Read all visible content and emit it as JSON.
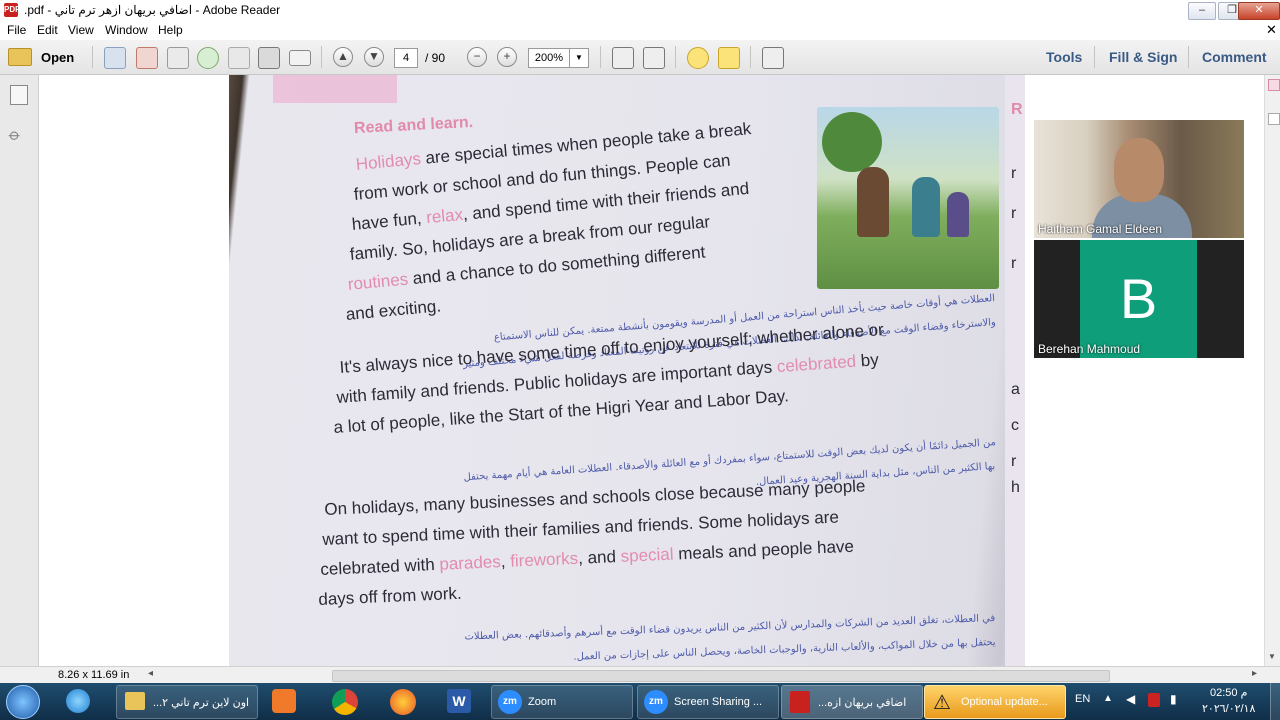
{
  "window": {
    "title": ".pdf - اضافي بريهان ازهر ترم تاني - Adobe Reader",
    "minimize": "–",
    "restore": "❐",
    "close": "✕"
  },
  "menu": [
    "File",
    "Edit",
    "View",
    "Window",
    "Help"
  ],
  "toolbar": {
    "open_label": "Open",
    "page_current": "4",
    "page_total": "/ 90",
    "zoom": "200%",
    "tools": "Tools",
    "fill_sign": "Fill & Sign",
    "comment": "Comment"
  },
  "document": {
    "heading": "Read and learn.",
    "p1": [
      {
        "pre": "",
        "hl": "Holidays",
        "post": " are special times when people take a break"
      },
      {
        "pre": "from work or school and do fun things. People can",
        "hl": "",
        "post": ""
      },
      {
        "pre": "have fun, ",
        "hl": "relax",
        "post": ", and spend time with their friends and"
      },
      {
        "pre": "family. So, holidays are a break from our regular",
        "hl": "",
        "post": ""
      },
      {
        "pre": "",
        "hl": "routines",
        "post": " and a chance to do something different"
      },
      {
        "pre": "and exciting.",
        "hl": "",
        "post": ""
      }
    ],
    "ar1": [
      "العطلات هي أوقات خاصة حيث يأخذ الناس استراحة من العمل أو المدرسة ويقومون بأنشطة ممتعة. يمكن للناس الاستمتاع",
      "والاسترخاء وقضاء الوقت مع الأصدقاء والعائلة. لذلك، العطلات هي فترة للابتعاد عن روتيننا المعتاد وفرصة لفعل شيء مختلف ومثير"
    ],
    "p2": [
      {
        "pre": "It's always nice to have some time off to enjoy yourself; whether alone or",
        "hl": "",
        "post": ""
      },
      {
        "pre": "with family and friends. Public holidays are important days ",
        "hl": "celebrated",
        "post": " by"
      },
      {
        "pre": "a lot of people, like the Start of the Higri Year and Labor Day.",
        "hl": "",
        "post": ""
      }
    ],
    "ar2": [
      "من الجميل دائمًا أن يكون لديك بعض الوقت للاستمتاع، سواء بمفردك أو مع العائلة والأصدقاء. العطلات العامة هي أيام مهمة يحتفل",
      "بها الكثير من الناس، مثل بداية السنة الهجرية وعيد العمال."
    ],
    "p3": [
      {
        "pre": "On holidays, many businesses and schools close because many people",
        "hl": "",
        "post": ""
      },
      {
        "pre": "want to spend time with their families and friends. Some holidays are",
        "hl": "",
        "post": ""
      },
      {
        "pre": "celebrated with ",
        "hl": "parades",
        "post": ", ",
        "hl2": "fireworks",
        "post2": ", and ",
        "hl3": "special",
        "post3": " meals and people have"
      },
      {
        "pre": "days off from work.",
        "hl": "",
        "post": ""
      }
    ],
    "ar3": [
      "في العطلات، تغلق العديد من الشركات والمدارس لأن الكثير من الناس يريدون قضاء الوقت مع أسرهم وأصدقائهم. بعض العطلات",
      "يحتفل بها من خلال المواكب، والألعاب النارية، والوجبات الخاصة، ويحصل الناس على إجازات من العمل."
    ],
    "right_page_letters": [
      "R",
      "r",
      "r",
      "r",
      "a",
      "c",
      "r",
      "h"
    ]
  },
  "video": {
    "tile1_name": "Haitham Gamal Eldeen",
    "tile2_name": "Berehan Mahmoud",
    "tile2_initial": "B"
  },
  "statusbar": {
    "page_size": "8.26 x 11.69 in"
  },
  "taskbar": {
    "folder_label": "...اون لاين ترم تاني ٢",
    "zoom_label": "Zoom",
    "screen_sharing_label": "Screen Sharing ...",
    "pdf_label": "...اضافي بريهان ازه",
    "update_label": "Optional update...",
    "lang": "EN",
    "time": "02:50 م",
    "date": "٢٠٢٦/٠٢/١٨"
  },
  "colors": {
    "accent_pink": "#e28cb0",
    "arabic_blue": "#4d5aa9",
    "zoom_blue": "#2d8cff",
    "avatar_green": "#0e9e7a"
  }
}
